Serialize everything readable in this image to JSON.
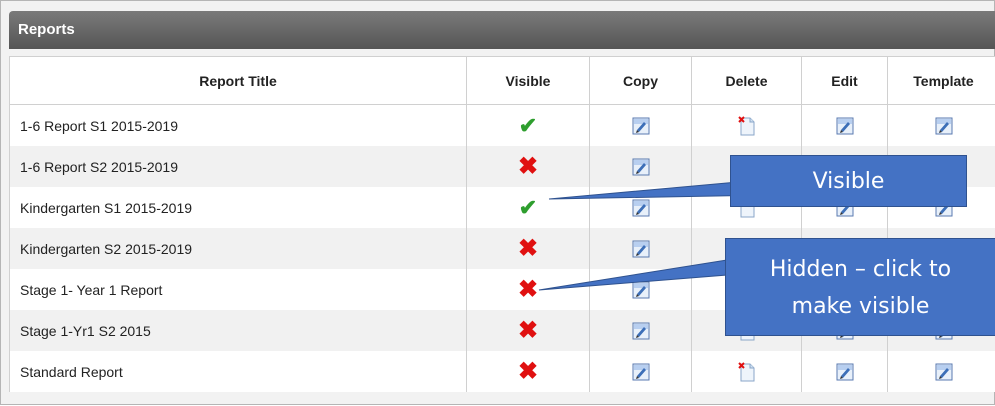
{
  "panel": {
    "title": "Reports"
  },
  "columns": {
    "title": "Report Title",
    "visible": "Visible",
    "copy": "Copy",
    "delete": "Delete",
    "edit": "Edit",
    "template": "Template"
  },
  "rows": [
    {
      "title": "1-6 Report S1 2015-2019",
      "visible": true
    },
    {
      "title": "1-6 Report S2 2015-2019",
      "visible": false
    },
    {
      "title": "Kindergarten S1 2015-2019",
      "visible": true
    },
    {
      "title": "Kindergarten S2 2015-2019",
      "visible": false
    },
    {
      "title": "Stage 1- Year 1 Report",
      "visible": false
    },
    {
      "title": "Stage 1-Yr1 S2 2015",
      "visible": false
    },
    {
      "title": "Standard Report",
      "visible": false
    }
  ],
  "icons": {
    "visible_true": "check-icon",
    "visible_false": "cross-icon",
    "copy": "copy-icon",
    "delete": "delete-icon",
    "edit": "edit-icon",
    "template": "template-icon"
  },
  "callouts": {
    "visible": "Visible",
    "hidden_line1": "Hidden – click to",
    "hidden_line2": "make visible"
  },
  "colors": {
    "check": "#2e9e2e",
    "cross": "#e01010",
    "callout": "#4472c4",
    "header": "#555555"
  }
}
